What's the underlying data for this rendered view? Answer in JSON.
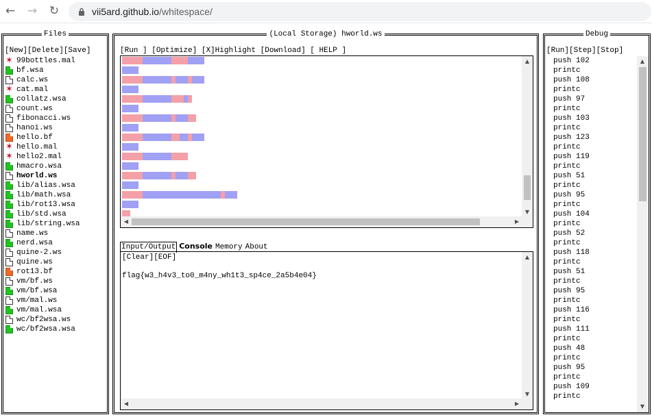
{
  "browser": {
    "url_host": "vii5ard.github.io",
    "url_path": "/whitespace/"
  },
  "files_panel": {
    "title": "Files",
    "toolbar": [
      "[New]",
      "[Delete]",
      "[Save]"
    ],
    "items": [
      {
        "name": "99bottles.mal",
        "icon": "bug-icon"
      },
      {
        "name": "bf.wsa",
        "icon": "green-file-icon"
      },
      {
        "name": "calc.ws",
        "icon": "file-icon"
      },
      {
        "name": "cat.mal",
        "icon": "bug-icon"
      },
      {
        "name": "collatz.wsa",
        "icon": "green-file-icon"
      },
      {
        "name": "count.ws",
        "icon": "file-icon"
      },
      {
        "name": "fibonacci.ws",
        "icon": "file-icon"
      },
      {
        "name": "hanoi.ws",
        "icon": "file-icon"
      },
      {
        "name": "hello.bf",
        "icon": "orange-file-icon"
      },
      {
        "name": "hello.mal",
        "icon": "bug-icon"
      },
      {
        "name": "hello2.mal",
        "icon": "bug-icon"
      },
      {
        "name": "hmacro.wsa",
        "icon": "green-file-icon"
      },
      {
        "name": "hworld.ws",
        "icon": "file-icon",
        "active": true
      },
      {
        "name": "lib/alias.wsa",
        "icon": "green-file-icon"
      },
      {
        "name": "lib/math.wsa",
        "icon": "green-file-icon"
      },
      {
        "name": "lib/rot13.wsa",
        "icon": "green-file-icon"
      },
      {
        "name": "lib/std.wsa",
        "icon": "green-file-icon"
      },
      {
        "name": "lib/string.wsa",
        "icon": "green-file-icon"
      },
      {
        "name": "name.ws",
        "icon": "file-icon"
      },
      {
        "name": "nerd.wsa",
        "icon": "green-file-icon"
      },
      {
        "name": "quine-2.ws",
        "icon": "file-icon"
      },
      {
        "name": "quine.ws",
        "icon": "file-icon"
      },
      {
        "name": "rot13.bf",
        "icon": "orange-file-icon"
      },
      {
        "name": "vm/bf.ws",
        "icon": "file-icon"
      },
      {
        "name": "vm/bf.wsa",
        "icon": "green-file-icon"
      },
      {
        "name": "vm/mal.ws",
        "icon": "file-icon"
      },
      {
        "name": "vm/mal.wsa",
        "icon": "green-file-icon"
      },
      {
        "name": "wc/bf2wsa.ws",
        "icon": "file-icon"
      },
      {
        "name": "wc/bf2wsa.wsa",
        "icon": "green-file-icon"
      }
    ]
  },
  "editor_panel": {
    "title": "(Local Storage) hworld.ws",
    "toolbar": [
      "[Run ]",
      "[Optimize]",
      "[X]Highlight",
      "[Download]",
      "[ HELP ]"
    ],
    "highlight_colors": {
      "space": "#f4a0a8",
      "tab": "#a0a0f4"
    },
    "tabs": [
      {
        "label": "Input/Output",
        "active": true,
        "bold": false
      },
      {
        "label": "Console",
        "active": false,
        "bold": true
      },
      {
        "label": "Memory",
        "active": false,
        "bold": false
      },
      {
        "label": "About",
        "active": false,
        "bold": false
      }
    ],
    "io_toolbar": "[Clear][EOF]",
    "output": "flag{w3_h4v3_to0_m4ny_wh1t3_sp4ce_2a5b4e04}"
  },
  "debug_panel": {
    "title": "Debug",
    "toolbar": [
      "[Run]",
      "[Step]",
      "[Stop]"
    ],
    "items": [
      "push 102",
      "printc",
      "push 108",
      "printc",
      "push 97",
      "printc",
      "push 103",
      "printc",
      "push 123",
      "printc",
      "push 119",
      "printc",
      "push 51",
      "printc",
      "push 95",
      "printc",
      "push 104",
      "printc",
      "push 52",
      "printc",
      "push 118",
      "printc",
      "push 51",
      "printc",
      "push 95",
      "printc",
      "push 116",
      "printc",
      "push 111",
      "printc",
      "push 48",
      "printc",
      "push 95",
      "printc",
      "push 109",
      "printc"
    ]
  }
}
